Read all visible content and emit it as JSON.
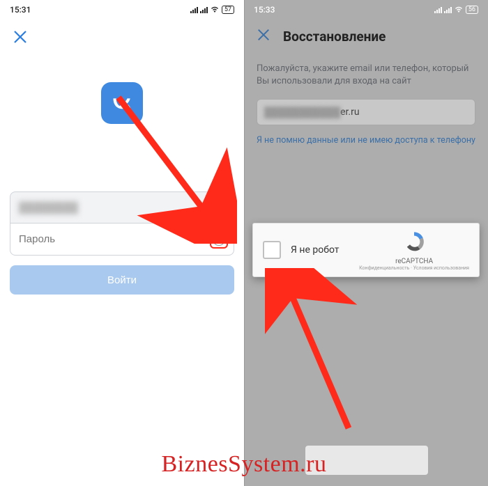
{
  "left": {
    "status": {
      "time": "15:31",
      "battery": "57"
    },
    "password_placeholder": "Пароль",
    "login_button": "Войти"
  },
  "right": {
    "status": {
      "time": "15:33",
      "battery": "56"
    },
    "title": "Восстановление",
    "instruction": "Пожалуйста, укажите email или телефон, который Вы использовали для входа на сайт",
    "email_suffix": "er.ru",
    "forgot_link": "Я не помню данные или не имею доступа к телефону",
    "captcha": {
      "label": "Я не робот",
      "brand": "reCAPTCHA",
      "terms": "Конфиденциальность · Условия использования"
    }
  },
  "watermark": "BiznesSystem.ru",
  "colors": {
    "accent": "#3f8ae0",
    "arrow": "#ff2a1a"
  }
}
